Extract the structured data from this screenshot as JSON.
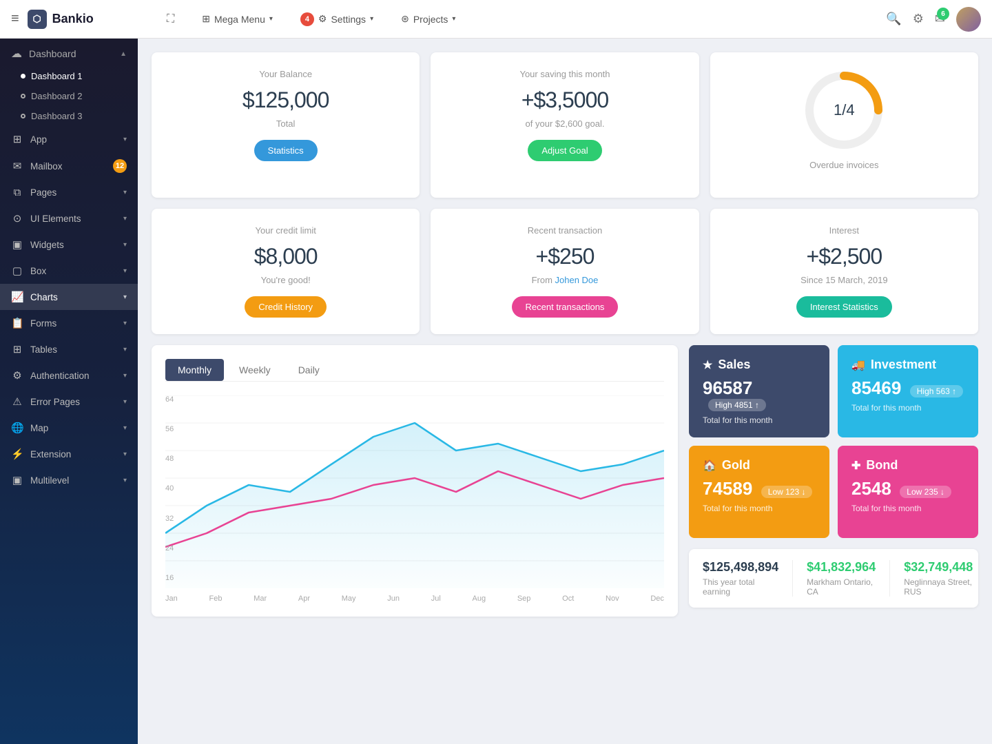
{
  "app": {
    "name": "Bankio",
    "logo_icon": "cube"
  },
  "topbar": {
    "hamburger_icon": "≡",
    "mega_menu": "Mega Menu",
    "settings_badge": "4",
    "settings": "Settings",
    "projects": "Projects",
    "notifications_badge": "6"
  },
  "sidebar": {
    "dashboard_section": "Dashboard",
    "dashboard_items": [
      "Dashboard 1",
      "Dashboard 2",
      "Dashboard 3"
    ],
    "nav_items": [
      {
        "label": "App",
        "icon": "⊞"
      },
      {
        "label": "Mailbox",
        "icon": "✉",
        "badge": "12"
      },
      {
        "label": "Pages",
        "icon": "⧉"
      },
      {
        "label": "UI Elements",
        "icon": "⊙"
      },
      {
        "label": "Widgets",
        "icon": "▣"
      },
      {
        "label": "Box",
        "icon": "▢"
      },
      {
        "label": "Charts",
        "icon": "📈",
        "active": true
      },
      {
        "label": "Forms",
        "icon": "📋"
      },
      {
        "label": "Tables",
        "icon": "⊞"
      },
      {
        "label": "Authentication",
        "icon": "⚙"
      },
      {
        "label": "Error Pages",
        "icon": "⚠"
      },
      {
        "label": "Map",
        "icon": "🌐"
      },
      {
        "label": "Extension",
        "icon": "⚡"
      },
      {
        "label": "Multilevel",
        "icon": "▣"
      }
    ]
  },
  "cards": {
    "balance": {
      "label": "Your Balance",
      "value": "$125,000",
      "sublabel": "Total",
      "button": "Statistics"
    },
    "saving": {
      "label": "Your saving this month",
      "value": "+$3,5000",
      "sublabel": "of your $2,600 goal.",
      "button": "Adjust Goal"
    },
    "invoices": {
      "fraction": "1/4",
      "sublabel": "Overdue invoices",
      "donut_progress": 25
    },
    "credit": {
      "label": "Your credit limit",
      "value": "$8,000",
      "sublabel": "You're good!",
      "button": "Credit History"
    },
    "transaction": {
      "label": "Recent transaction",
      "value": "+$250",
      "sublabel_prefix": "From ",
      "sublabel_name": "Johen Doe",
      "button": "Recent transactions"
    },
    "interest": {
      "label": "Interest",
      "value": "+$2,500",
      "sublabel": "Since 15 March, 2019",
      "button": "Interest Statistics"
    }
  },
  "chart": {
    "tabs": [
      "Monthly",
      "Weekly",
      "Daily"
    ],
    "active_tab": "Monthly",
    "y_labels": [
      "64",
      "56",
      "48",
      "40",
      "32",
      "24",
      "16"
    ],
    "x_labels": [
      "Jan",
      "Feb",
      "Mar",
      "Apr",
      "May",
      "Jun",
      "Jul",
      "Aug",
      "Sep",
      "Oct",
      "Nov",
      "Dec"
    ]
  },
  "stat_cards": [
    {
      "id": "sales",
      "title": "Sales",
      "icon": "★",
      "value": "96587",
      "badge_type": "High",
      "badge_value": "4851",
      "badge_arrow": "↑",
      "footer": "Total for this month",
      "color": "blue"
    },
    {
      "id": "investment",
      "title": "Investment",
      "icon": "🚚",
      "value": "85469",
      "badge_type": "High",
      "badge_value": "563",
      "badge_arrow": "↑",
      "footer": "Total for this month",
      "color": "cyan"
    },
    {
      "id": "gold",
      "title": "Gold",
      "icon": "🏠",
      "value": "74589",
      "badge_type": "Low",
      "badge_value": "123",
      "badge_arrow": "↓",
      "footer": "Total for this month",
      "color": "orange"
    },
    {
      "id": "bond",
      "title": "Bond",
      "icon": "✚",
      "value": "2548",
      "badge_type": "Low",
      "badge_value": "235",
      "badge_arrow": "↓",
      "footer": "Total for this month",
      "color": "pink"
    }
  ],
  "stats_bar": [
    {
      "value": "$125,498,894",
      "label": "This year total earning",
      "color": "dark"
    },
    {
      "value": "$41,832,964",
      "label": "Markham Ontario, CA",
      "color": "green"
    },
    {
      "value": "$32,749,448",
      "label": "Neglinnaya Street, RUS",
      "color": "green"
    }
  ]
}
